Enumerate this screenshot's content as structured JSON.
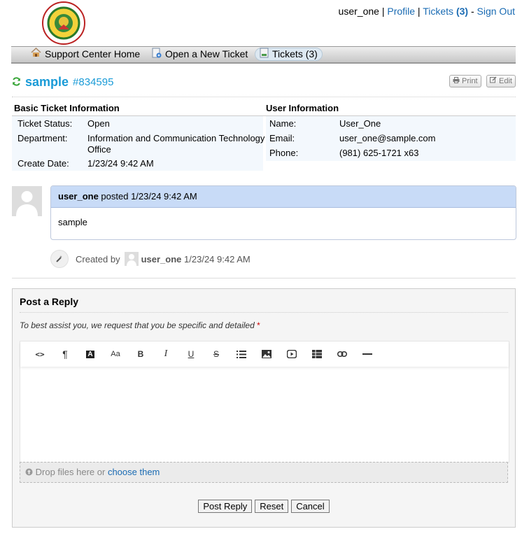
{
  "header": {
    "logo_text": "MINDANAO STATE UNIVERSITY GEN. SANTOS CITY",
    "user": "user_one",
    "sep1": " | ",
    "profile": "Profile",
    "sep2": " | ",
    "tickets": "Tickets",
    "tickets_count": "(3)",
    "sep3": " - ",
    "signout": "Sign Out"
  },
  "nav": {
    "home": "Support Center Home",
    "new_ticket": "Open a New Ticket",
    "tickets": "Tickets (3)"
  },
  "ticket": {
    "name": "sample",
    "number": "#834595",
    "print": "Print",
    "edit": "Edit"
  },
  "basic_info": {
    "heading": "Basic Ticket Information",
    "status_label": "Ticket Status:",
    "status_value": "Open",
    "dept_label": "Department:",
    "dept_value_1": "Information and Communication Technology",
    "dept_value_2": "Office",
    "date_label": "Create Date:",
    "date_value": "1/23/24 9:42 AM"
  },
  "user_info": {
    "heading": "User Information",
    "name_label": "Name:",
    "name_value": "User_One",
    "email_label": "Email:",
    "email_value": "user_one@sample.com",
    "phone_label": "Phone:",
    "phone_value": "(981) 625-1721 x63"
  },
  "thread": {
    "poster": "user_one",
    "posted_text": " posted 1/23/24 9:42 AM",
    "body": "sample",
    "event_prefix": "Created by",
    "event_user": "user_one",
    "event_time": "1/23/24 9:42 AM"
  },
  "reply": {
    "title": "Post a Reply",
    "hint": "To best assist you, we request that you be specific and detailed",
    "required_mark": "*",
    "drop_text": "Drop files here or ",
    "drop_link": "choose them",
    "post_button": "Post Reply",
    "reset_button": "Reset",
    "cancel_button": "Cancel"
  },
  "toolbar_icons": [
    "code-view-icon",
    "paragraph-icon",
    "font-color-icon",
    "font-size-icon",
    "bold-icon",
    "italic-icon",
    "underline-icon",
    "strikethrough-icon",
    "list-icon",
    "image-icon",
    "video-icon",
    "table-icon",
    "link-icon",
    "horizontal-rule-icon"
  ],
  "colors": {
    "accent": "#1a9bd7",
    "link": "#1a6bb3",
    "thread_header": "#c8dbf7",
    "required": "#cc0000"
  }
}
